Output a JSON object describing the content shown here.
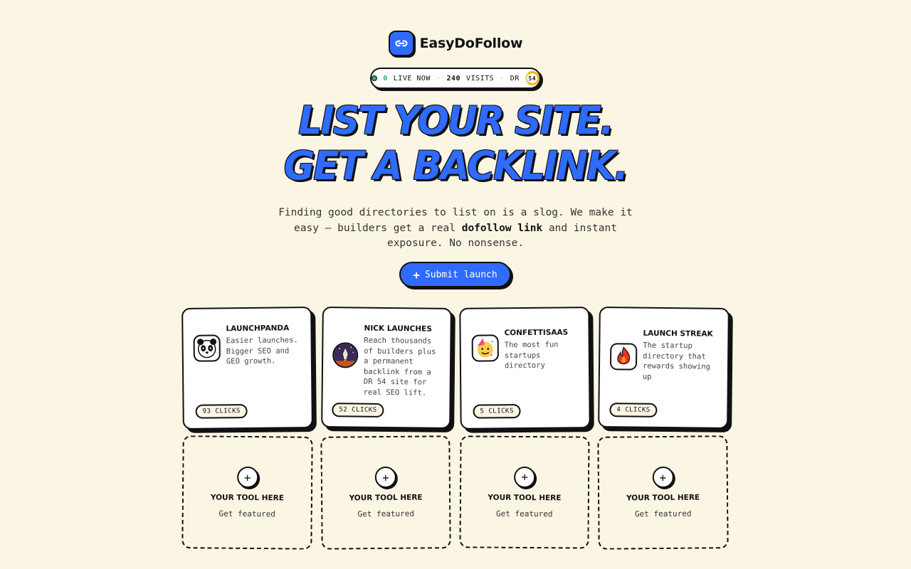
{
  "brand": {
    "name": "EasyDoFollow",
    "icon": "link-icon",
    "accent": "#2f6bff"
  },
  "stats": {
    "live_count": "0",
    "live_label": "LIVE NOW",
    "visits_count": "240",
    "visits_label": "VISITS",
    "dr_label": "DR",
    "dr_value": "54",
    "separator": "·"
  },
  "hero": {
    "line1": "LIST YOUR SITE.",
    "line2": "GET A BACKLINK.",
    "sub_a": "Finding good directories to list on is a slog. We make it easy — builders get a real ",
    "sub_bold": "dofollow link",
    "sub_b": " and instant exposure. No nonsense.",
    "cta_plus": "+",
    "cta_label": "Submit launch"
  },
  "featured": [
    {
      "title": "LAUNCHPANDA",
      "desc": "Easier launches. Bigger SEO and GEO growth.",
      "clicks": "93 CLICKS",
      "icon": "panda-icon"
    },
    {
      "title": "NICK LAUNCHES",
      "desc": "Reach thousands of builders plus a permanent backlink from a DR 54 site for real SEO lift.",
      "clicks": "52 CLICKS",
      "icon": "rocket-icon"
    },
    {
      "title": "CONFETTISAAS",
      "desc": "The most fun startups directory",
      "clicks": "5 CLICKS",
      "icon": "party-face-icon"
    },
    {
      "title": "LAUNCH STREAK",
      "desc": "The startup directory that rewards showing up",
      "clicks": "4 CLICKS",
      "icon": "flame-icon"
    }
  ],
  "slots": [
    {
      "plus": "+",
      "title": "YOUR TOOL HERE",
      "sub": "Get featured"
    },
    {
      "plus": "+",
      "title": "YOUR TOOL HERE",
      "sub": "Get featured"
    },
    {
      "plus": "+",
      "title": "YOUR TOOL HERE",
      "sub": "Get featured"
    },
    {
      "plus": "+",
      "title": "YOUR TOOL HERE",
      "sub": "Get featured"
    }
  ]
}
